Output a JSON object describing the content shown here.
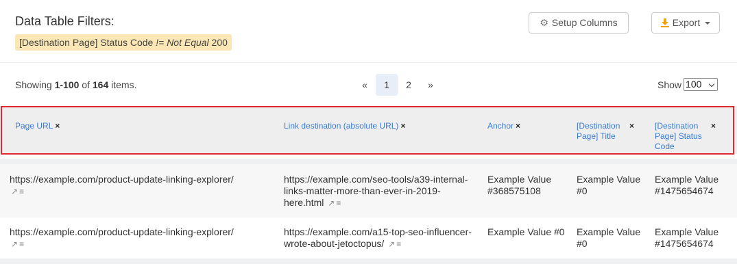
{
  "filters": {
    "title": "Data Table Filters:",
    "chip_prefix": "[Destination Page] Status Code ",
    "chip_operator": "!= Not Equal",
    "chip_value": " 200"
  },
  "toolbar": {
    "setup_columns_label": "Setup Columns",
    "export_label": "Export"
  },
  "summary": {
    "showing_label": "Showing ",
    "range": "1-100",
    "of_label": " of ",
    "total": "164",
    "items_label": " items."
  },
  "pagination": {
    "prev": "«",
    "pages": [
      "1",
      "2"
    ],
    "current": "1",
    "next": "»"
  },
  "show": {
    "label": "Show",
    "selected": "100"
  },
  "table": {
    "columns": [
      {
        "label": "Page URL",
        "remove": "×"
      },
      {
        "label": "Link destination (absolute URL)",
        "remove": "×"
      },
      {
        "label": "Anchor",
        "remove": "×"
      },
      {
        "label": "[Destination Page] Title",
        "remove": "×"
      },
      {
        "label": "[Destination Page] Status Code",
        "remove": "×"
      }
    ],
    "rows": [
      {
        "page_url": "https://example.com/product-update-linking-explorer/",
        "link_destination": "https://example.com/seo-tools/a39-internal-links-matter-more-than-ever-in-2019-here.html",
        "anchor": "Example Value #368575108",
        "dest_title": "Example Value #0",
        "dest_status": "Example Value #1475654674"
      },
      {
        "page_url": "https://example.com/product-update-linking-explorer/",
        "link_destination": "https://example.com/a15-top-seo-influencer-wrote-about-jetoctopus/",
        "anchor": "Example Value #0",
        "dest_title": "Example Value #0",
        "dest_status": "Example Value #1475654674"
      }
    ]
  },
  "icons": {
    "external_link": "external-link-icon",
    "menu": "menu-icon",
    "gear": "gear-icon",
    "download": "download-icon"
  },
  "colors": {
    "link": "#3a7bd5",
    "highlight_border": "#e0282e",
    "filter_chip_bg": "#fbe7b5",
    "export_icon": "#f0a30a"
  }
}
